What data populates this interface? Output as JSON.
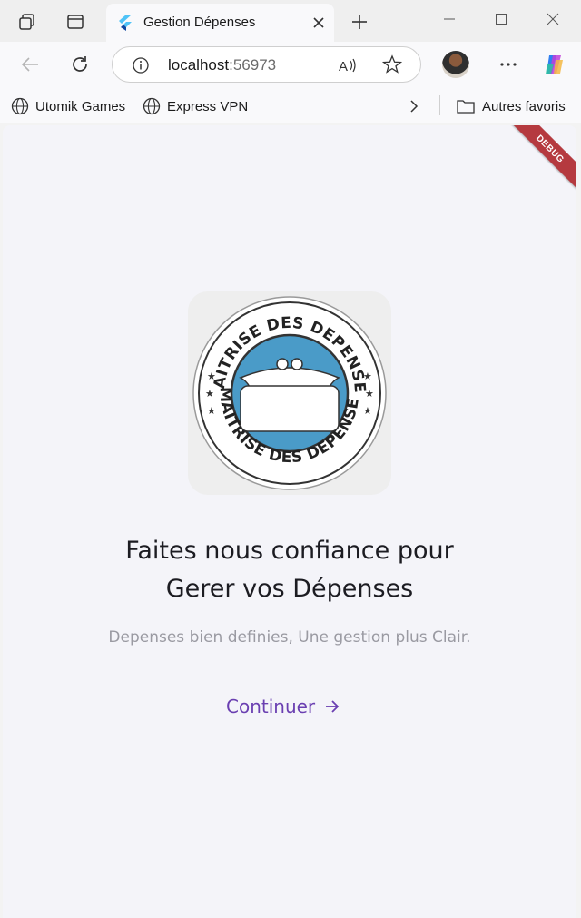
{
  "browser": {
    "tab_title": "Gestion Dépenses",
    "url_host": "localhost",
    "url_port": ":56973",
    "bookmarks": [
      {
        "label": "Utomik Games",
        "icon": "globe-icon"
      },
      {
        "label": "Express VPN",
        "icon": "globe-icon"
      }
    ],
    "other_favorites_label": "Autres favoris"
  },
  "app": {
    "debug_label": "DEBUG",
    "logo_text_top": "MAITRISE DES DEPENSES",
    "logo_text_bottom": "MAITRISE DES DEPENSES",
    "headline_line1": "Faites nous confiance pour",
    "headline_line2": "Gerer vos Dépenses",
    "subtitle": "Depenses bien definies, Une gestion plus Clair.",
    "continue_label": "Continuer",
    "accent_color": "#6a3fb1",
    "logo_blue": "#4a9bc8"
  }
}
